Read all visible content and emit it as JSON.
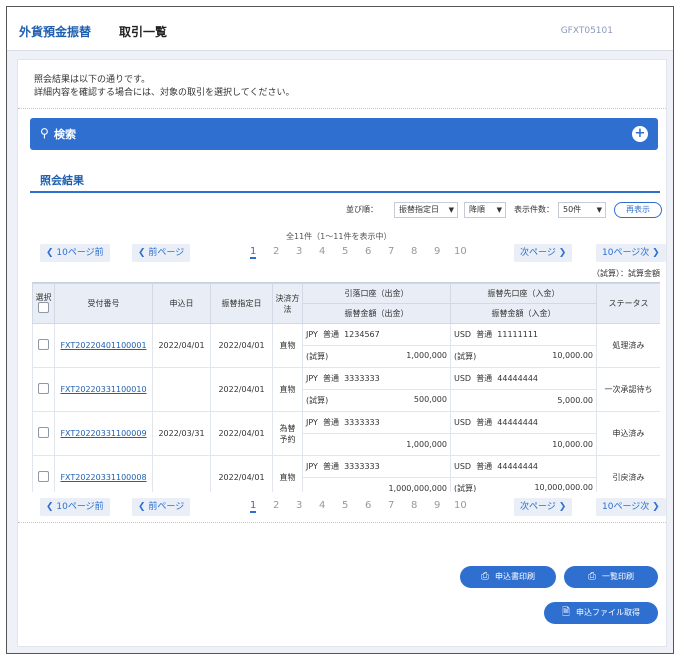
{
  "header": {
    "service": "外貨預金振替",
    "title": "取引一覧",
    "screen_code": "GFXT05101"
  },
  "message": {
    "line1": "照会結果は以下の通りです。",
    "line2": "詳細内容を確認する場合には、対象の取引を選択してください。"
  },
  "search": {
    "label": "検索",
    "icon": "search-icon"
  },
  "results": {
    "title": "照会結果"
  },
  "sort": {
    "sort_label": "並び順：",
    "sort_value": "振替指定日",
    "order_value": "降順",
    "count_label": "表示件数：",
    "count_value": "50件",
    "redisplay_label": "再表示"
  },
  "summary": "全11件（1〜11件を表示中）",
  "pager": {
    "prev10": "10ページ前",
    "prev": "前ページ",
    "next": "次ページ",
    "next10": "10ページ次",
    "pages": [
      "1",
      "2",
      "3",
      "4",
      "5",
      "6",
      "7",
      "8",
      "9",
      "10"
    ],
    "current": "1"
  },
  "note": "（試算）：試算金額",
  "table": {
    "headers": {
      "select": "選択",
      "ref_no": "受付番号",
      "apply_date": "申込日",
      "transfer_date": "振替指定日",
      "settlement": "決済方法",
      "from_account": "引落口座（出金）",
      "from_amount": "振替金額（出金）",
      "to_account": "振替先口座（入金）",
      "to_amount": "振替金額（入金）",
      "status": "ステータス"
    },
    "rows": [
      {
        "ref_no": "FXT20220401100001",
        "apply_date": "2022/04/01",
        "transfer_date": "2022/04/01",
        "settlement": "直物",
        "from_ccy": "JPY",
        "from_type": "普通",
        "from_no": "1234567",
        "from_est": "(試算)",
        "from_amount": "1,000,000",
        "to_ccy": "USD",
        "to_type": "普通",
        "to_no": "11111111",
        "to_est": "(試算)",
        "to_amount": "10,000.00",
        "status": "処理済み"
      },
      {
        "ref_no": "FXT20220331100010",
        "apply_date": "",
        "transfer_date": "2022/04/01",
        "settlement": "直物",
        "from_ccy": "JPY",
        "from_type": "普通",
        "from_no": "3333333",
        "from_est": "(試算)",
        "from_amount": "500,000",
        "to_ccy": "USD",
        "to_type": "普通",
        "to_no": "44444444",
        "to_est": "",
        "to_amount": "5,000.00",
        "status": "一次承認待ち"
      },
      {
        "ref_no": "FXT20220331100009",
        "apply_date": "2022/03/31",
        "transfer_date": "2022/04/01",
        "settlement": "為替予約",
        "from_ccy": "JPY",
        "from_type": "普通",
        "from_no": "3333333",
        "from_est": "",
        "from_amount": "1,000,000",
        "to_ccy": "USD",
        "to_type": "普通",
        "to_no": "44444444",
        "to_est": "",
        "to_amount": "10,000.00",
        "status": "申込済み"
      },
      {
        "ref_no": "FXT20220331100008",
        "apply_date": "",
        "transfer_date": "2022/04/01",
        "settlement": "直物",
        "from_ccy": "JPY",
        "from_type": "普通",
        "from_no": "3333333",
        "from_est": "",
        "from_amount": "1,000,000,000",
        "to_ccy": "USD",
        "to_type": "普通",
        "to_no": "44444444",
        "to_est": "(試算)",
        "to_amount": "10,000,000.00",
        "status": "引戻済み"
      }
    ]
  },
  "actions": {
    "print_application": "申込書印刷",
    "print_list": "一覧印刷",
    "get_file": "申込ファイル取得"
  },
  "colors": {
    "accent": "#2f6fd0",
    "link": "#1f5fb0",
    "background": "#eef1f7"
  }
}
